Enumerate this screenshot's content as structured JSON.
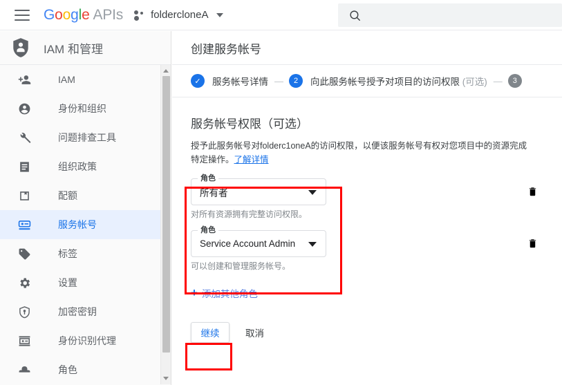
{
  "topbar": {
    "menu_icon": "hamburger-menu-icon",
    "logo": {
      "brand": "Google",
      "letters": [
        "G",
        "o",
        "o",
        "g",
        "l",
        "e"
      ],
      "suffix": "APIs"
    },
    "project": {
      "icon": "project-dots-icon",
      "name": "foldercloneA",
      "caret_icon": "chevron-down-icon"
    },
    "search": {
      "icon": "search-icon",
      "value": "",
      "placeholder": ""
    }
  },
  "sidebar": {
    "header": {
      "icon": "iam-shield-person-icon",
      "title": "IAM 和管理"
    },
    "items": [
      {
        "icon": "person-add-icon",
        "label": "IAM",
        "active": false
      },
      {
        "icon": "account-circle-icon",
        "label": "身份和组织",
        "active": false
      },
      {
        "icon": "wrench-icon",
        "label": "问题排查工具",
        "active": false
      },
      {
        "icon": "document-icon",
        "label": "组织政策",
        "active": false
      },
      {
        "icon": "quota-icon",
        "label": "配额",
        "active": false
      },
      {
        "icon": "service-account-icon",
        "label": "服务帐号",
        "active": true
      },
      {
        "icon": "label-tag-icon",
        "label": "标签",
        "active": false
      },
      {
        "icon": "gear-icon",
        "label": "设置",
        "active": false
      },
      {
        "icon": "key-shield-icon",
        "label": "加密密钥",
        "active": false
      },
      {
        "icon": "identity-proxy-icon",
        "label": "身份识别代理",
        "active": false
      },
      {
        "icon": "roles-hat-icon",
        "label": "角色",
        "active": false
      }
    ],
    "scrollbar": {
      "up_arrow_icon": "scroll-up-arrow-icon",
      "down_arrow_icon": "scroll-down-arrow-icon"
    }
  },
  "main": {
    "page_title": "创建服务帐号",
    "stepper": {
      "steps": [
        {
          "marker": "✓",
          "label": "服务帐号详情",
          "optional": "",
          "state": "done"
        },
        {
          "marker": "2",
          "label": "向此服务帐号授予对项目的访问权限",
          "optional": "(可选)",
          "state": "current"
        },
        {
          "marker": "3",
          "label": "",
          "optional": "",
          "state": "todo"
        }
      ],
      "separator": "—"
    },
    "section": {
      "title": "服务帐号权限（可选）",
      "description_part1": "授予此服务帐号对folderc1oneA的访问权限，以便该服务帐号有权对您项目中的资源完成特定操作。",
      "description_link": "了解详情"
    },
    "roles": [
      {
        "field_label": "角色",
        "value": "所有者",
        "hint": "对所有资源拥有完整访问权限。",
        "caret_icon": "chevron-down-icon",
        "delete_icon": "trash-icon"
      },
      {
        "field_label": "角色",
        "value": "Service Account Admin",
        "hint": "可以创建和管理服务帐号。",
        "caret_icon": "chevron-down-icon",
        "delete_icon": "trash-icon"
      }
    ],
    "add_role": {
      "plus": "+",
      "label": "添加其他角色"
    },
    "actions": {
      "continue_label": "继续",
      "cancel_label": "取消"
    }
  },
  "annotations": {
    "highlight_color": "#ff0000",
    "boxes": [
      "roles-group-highlight",
      "continue-button-highlight"
    ]
  },
  "colors": {
    "accent_blue": "#1a73e8",
    "active_nav_bg": "#e8f0fe",
    "sidebar_bg": "#fafafa",
    "muted_text": "#5f6368"
  }
}
